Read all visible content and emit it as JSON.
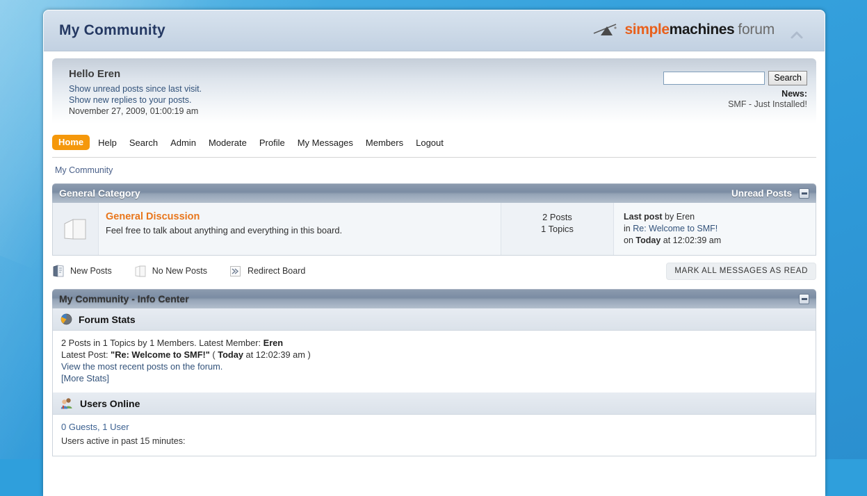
{
  "header": {
    "forum_title": "My Community",
    "logo": {
      "word1": "simple",
      "word2": "machines",
      "word3": "forum",
      "mark_icon": "smf-sledgehammer-icon"
    },
    "upshrink_icon": "chevron-up-icon"
  },
  "user_area": {
    "greeting": "Hello Eren",
    "links": [
      "Show unread posts since last visit.",
      "Show new replies to your posts."
    ],
    "timestamp": "November 27, 2009, 01:00:19 am",
    "search": {
      "value": "",
      "placeholder": "",
      "button_label": "Search"
    },
    "news_label": "News:",
    "news_text": "SMF - Just Installed!"
  },
  "nav": {
    "items": [
      {
        "label": "Home",
        "active": true
      },
      {
        "label": "Help",
        "active": false
      },
      {
        "label": "Search",
        "active": false
      },
      {
        "label": "Admin",
        "active": false
      },
      {
        "label": "Moderate",
        "active": false
      },
      {
        "label": "Profile",
        "active": false
      },
      {
        "label": "My Messages",
        "active": false
      },
      {
        "label": "Members",
        "active": false
      },
      {
        "label": "Logout",
        "active": false
      }
    ]
  },
  "breadcrumb": {
    "items": [
      "My Community"
    ]
  },
  "category": {
    "title": "General Category",
    "unread_link": "Unread Posts",
    "collapse_icon": "collapse-minus-icon",
    "board": {
      "icon": "no-new-posts-board-icon",
      "name": "General Discussion",
      "description": "Feel free to talk about anything and everything in this board.",
      "posts": "2 Posts",
      "topics": "1 Topics",
      "last_post_label": "Last post",
      "last_post_by": "by Eren",
      "last_post_in_prefix": "in",
      "last_post_subject": "Re: Welcome to SMF!",
      "last_post_on_prefix": "on",
      "last_post_day": "Today",
      "last_post_time": "at 12:02:39 am"
    }
  },
  "legend": {
    "items": [
      {
        "label": "New Posts",
        "icon": "new-posts-icon"
      },
      {
        "label": "No New Posts",
        "icon": "no-new-posts-icon"
      },
      {
        "label": "Redirect Board",
        "icon": "redirect-board-icon"
      }
    ],
    "mark_read_label": "MARK ALL MESSAGES AS READ"
  },
  "info_center": {
    "title": "My Community - Info Center",
    "collapse_icon": "collapse-minus-icon",
    "forum_stats": {
      "icon": "pie-chart-icon",
      "title": "Forum Stats",
      "line1_a": "2 Posts in 1 Topics by 1 Members. Latest Member: ",
      "line1_b": "Eren",
      "line2_a": "Latest Post: ",
      "line2_b": "\"Re: Welcome to SMF!\"",
      "line2_c": " ( ",
      "line2_d": "Today",
      "line2_e": " at 12:02:39 am )",
      "line3": "View the most recent posts on the forum.",
      "line4": "[More Stats]"
    },
    "users_online": {
      "icon": "users-group-icon",
      "title": "Users Online",
      "count_line": "0 Guests, 1 User",
      "active_line": "Users active in past 15 minutes:"
    }
  },
  "colors": {
    "page_background": "#2f9fdc",
    "accent_orange": "#e8761c",
    "nav_active": "#f5980b",
    "category_bar": "#7b8ca3",
    "link_blue": "#32527a",
    "title_navy": "#253963"
  }
}
